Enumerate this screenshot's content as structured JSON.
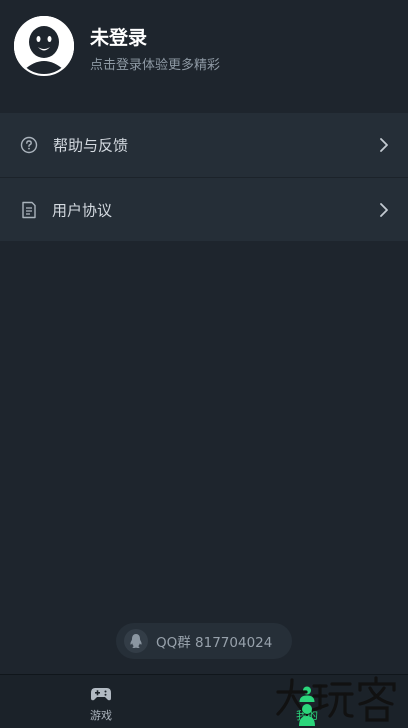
{
  "profile": {
    "username": "未登录",
    "subtitle": "点击登录体验更多精彩",
    "avatar_icon": "user-face-icon"
  },
  "menu": {
    "items": [
      {
        "label": "帮助与反馈",
        "icon": "help-circle-icon"
      },
      {
        "label": "用户协议",
        "icon": "document-icon"
      }
    ]
  },
  "qq_group": {
    "text": "QQ群 817704024",
    "icon": "qq-penguin-icon"
  },
  "tabbar": {
    "tabs": [
      {
        "label": "游戏",
        "icon": "gamepad-icon",
        "active": false
      },
      {
        "label": "我的",
        "icon": "profile-icon",
        "active": true
      }
    ]
  },
  "watermark": {
    "text": "大玩客"
  },
  "colors": {
    "background": "#1e252d",
    "menu_bg": "#252e37",
    "accent_green": "#2bd67b",
    "tabbar_bg": "#1b2229"
  }
}
